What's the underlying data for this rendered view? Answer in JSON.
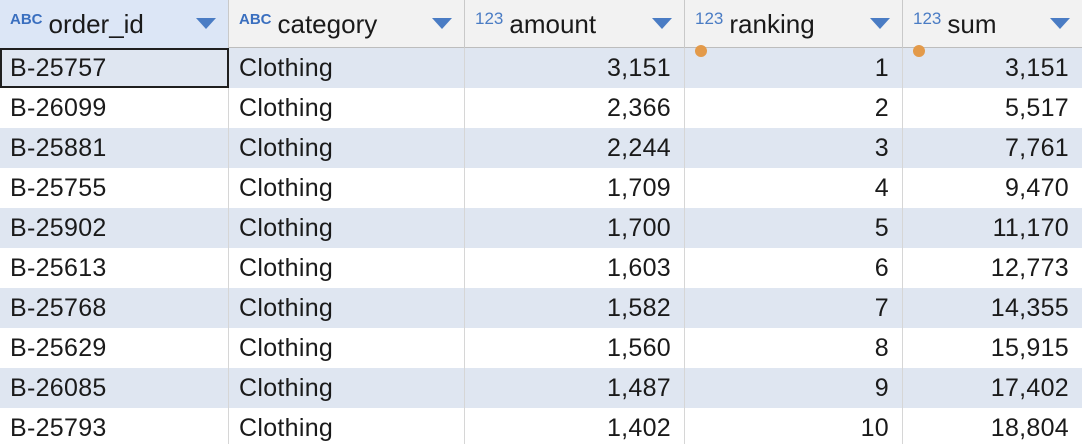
{
  "columns": [
    {
      "name": "order_id",
      "type_label": "ABC",
      "type": "text"
    },
    {
      "name": "category",
      "type_label": "ABC",
      "type": "text"
    },
    {
      "name": "amount",
      "type_label": "123",
      "type": "number"
    },
    {
      "name": "ranking",
      "type_label": "123",
      "type": "number"
    },
    {
      "name": "sum",
      "type_label": "123",
      "type": "number"
    }
  ],
  "rows": [
    {
      "order_id": "B-25757",
      "category": "Clothing",
      "amount": "3,151",
      "ranking": "1",
      "sum": "3,151"
    },
    {
      "order_id": "B-26099",
      "category": "Clothing",
      "amount": "2,366",
      "ranking": "2",
      "sum": "5,517"
    },
    {
      "order_id": "B-25881",
      "category": "Clothing",
      "amount": "2,244",
      "ranking": "3",
      "sum": "7,761"
    },
    {
      "order_id": "B-25755",
      "category": "Clothing",
      "amount": "1,709",
      "ranking": "4",
      "sum": "9,470"
    },
    {
      "order_id": "B-25902",
      "category": "Clothing",
      "amount": "1,700",
      "ranking": "5",
      "sum": "11,170"
    },
    {
      "order_id": "B-25613",
      "category": "Clothing",
      "amount": "1,603",
      "ranking": "6",
      "sum": "12,773"
    },
    {
      "order_id": "B-25768",
      "category": "Clothing",
      "amount": "1,582",
      "ranking": "7",
      "sum": "14,355"
    },
    {
      "order_id": "B-25629",
      "category": "Clothing",
      "amount": "1,560",
      "ranking": "8",
      "sum": "15,915"
    },
    {
      "order_id": "B-26085",
      "category": "Clothing",
      "amount": "1,487",
      "ranking": "9",
      "sum": "17,402"
    },
    {
      "order_id": "B-25793",
      "category": "Clothing",
      "amount": "1,402",
      "ranking": "10",
      "sum": "18,804"
    }
  ],
  "colors": {
    "header_bg": "#f2f2f2",
    "selected_header_bg": "#dce6f6",
    "alt_row_bg": "#dfe6f1",
    "type_icon": "#3a6fbf",
    "computed_marker": "#e39a4a"
  },
  "icons": {
    "sort": "chevron-down-icon",
    "computed": "orange-dot-icon"
  }
}
